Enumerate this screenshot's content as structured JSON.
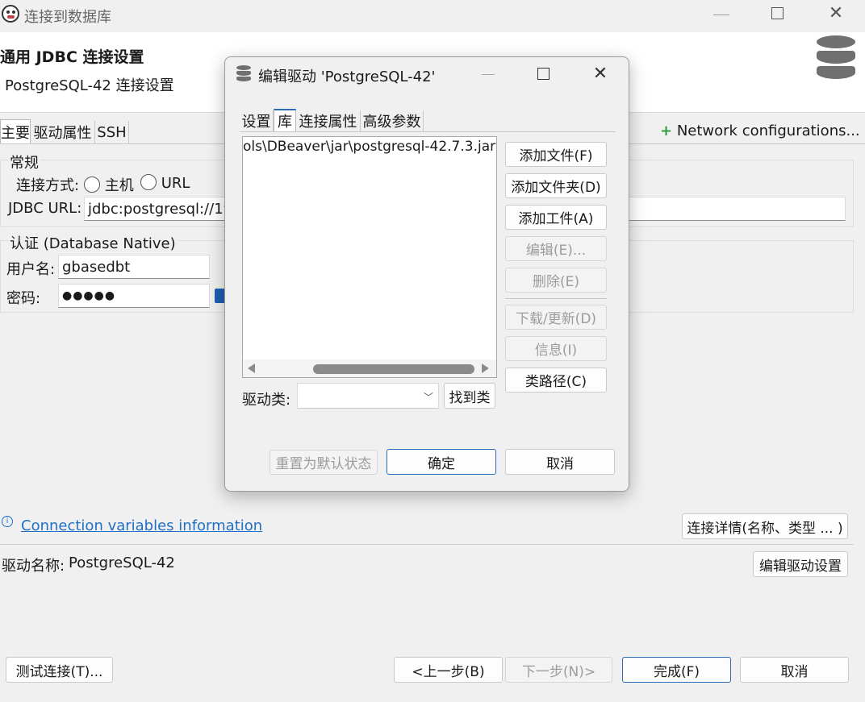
{
  "main_window": {
    "title": "连接到数据库",
    "header_title": "通用 JDBC 连接设置",
    "header_subtitle": "PostgreSQL-42 连接设置",
    "tabs": [
      "主要",
      "驱动属性",
      "SSH"
    ],
    "network_config": "Network configurations...",
    "general_group": "常规",
    "connect_method_label": "连接方式:",
    "radio_host": "主机",
    "radio_url": "URL",
    "jdbc_url_label": "JDBC URL:",
    "jdbc_url_value": "jdbc:postgresql://19",
    "auth_group": "认证 (Database Native)",
    "username_label": "用户名:",
    "username_value": "gbasedbt",
    "password_label": "密码:",
    "password_value": "●●●●●",
    "conn_vars_link": "Connection variables information",
    "conn_details_button": "连接详情(名称、类型 ... )",
    "driver_name_label": "驱动名称:",
    "driver_name_value": "PostgreSQL-42",
    "edit_driver_button": "编辑驱动设置",
    "test_connection_button": "测试连接(T)...",
    "back_button": "<上一步(B)",
    "next_button": "下一步(N)>",
    "finish_button": "完成(F)",
    "cancel_button": "取消"
  },
  "dialog": {
    "title": "编辑驱动 'PostgreSQL-42'",
    "tabs": [
      "设置",
      "库",
      "连接属性",
      "高级参数"
    ],
    "library_item": "ols\\DBeaver\\jar\\postgresql-42.7.3.jar",
    "add_file_button": "添加文件(F)",
    "add_folder_button": "添加文件夹(D)",
    "add_artifact_button": "添加工件(A)",
    "edit_button": "编辑(E)...",
    "delete_button": "删除(E)",
    "download_update_button": "下载/更新(D)",
    "info_button": "信息(I)",
    "classpath_button": "类路径(C)",
    "driver_class_label": "驱动类:",
    "driver_class_value": "",
    "find_class_button": "找到类",
    "reset_button": "重置为默认状态",
    "ok_button": "确定",
    "cancel_button": "取消"
  },
  "colors": {
    "accent": "#2b6cb8",
    "link": "#1f6fc5",
    "plus_green": "#2e9e3e"
  }
}
